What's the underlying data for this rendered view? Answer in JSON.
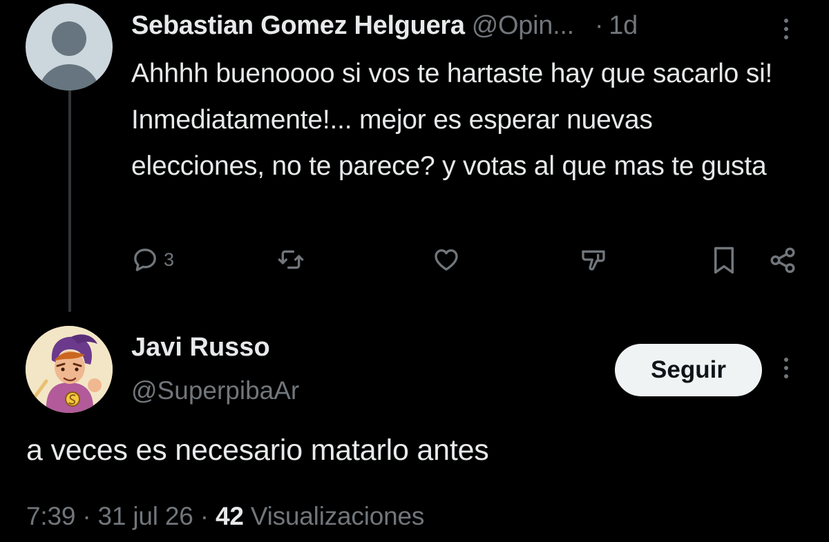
{
  "reply": {
    "author_name": "Sebastian Gomez Helguera",
    "handle": "@Opin...",
    "separator": "·",
    "time": "1d",
    "text": "Ahhhh buenoooo si vos te hartaste hay que sacarlo si! Inmediatamente!... mejor es esperar nuevas elecciones, no te parece? y votas al que mas te gusta",
    "actions": {
      "reply_count": "3",
      "icons": [
        "reply-icon",
        "retweet-icon",
        "like-icon",
        "stats-icon",
        "bookmark-icon",
        "share-icon"
      ]
    }
  },
  "main_post": {
    "author_name": "Javi Russo",
    "handle": "@SuperpibaAr",
    "follow_label": "Seguir",
    "text": "a veces es necesario matarlo antes",
    "meta": {
      "time": "7:39",
      "sep1": "·",
      "date": "31 jul 26",
      "sep2": "·",
      "views_count": "42",
      "views_label": "Visualizaciones"
    }
  },
  "colors": {
    "background": "#000000",
    "primary_text": "#e7e9ea",
    "secondary_text": "#71767b",
    "button_bg": "#eff3f4",
    "button_text": "#0f1419",
    "thread_line": "#333639"
  }
}
